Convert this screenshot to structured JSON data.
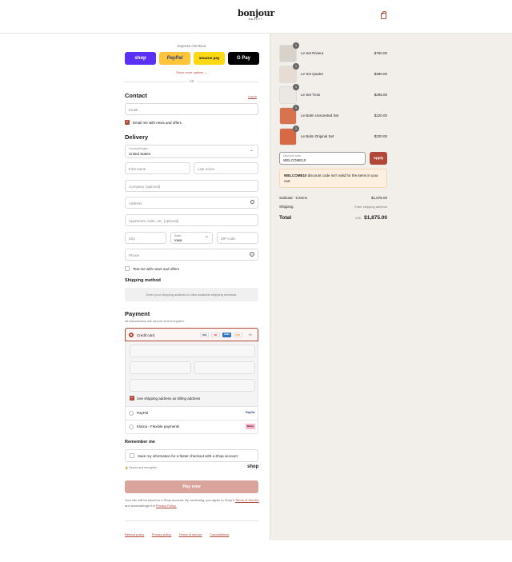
{
  "header": {
    "logo": "bonjour",
    "logo_sub": "BEAUTY",
    "cart_icon": "bag-icon"
  },
  "express": {
    "title": "Express checkout",
    "buttons": [
      {
        "label": "shop",
        "color": "#5a31f4"
      },
      {
        "label": "PayPal",
        "color": "#ffc439"
      },
      {
        "label": "amazon pay",
        "color": "#ffd814"
      },
      {
        "label": "G Pay",
        "color": "#000000"
      }
    ],
    "show_more": "Show more options",
    "or": "OR"
  },
  "contact": {
    "title": "Contact",
    "login": "Log in",
    "email_placeholder": "Email",
    "news_label": "Email me with news and offers"
  },
  "delivery": {
    "title": "Delivery",
    "country_label": "Country/Region",
    "country_value": "United States",
    "first_name": "First name",
    "last_name": "Last name",
    "company": "Company (optional)",
    "address": "Address",
    "apartment": "Apartment, suite, etc. (optional)",
    "city": "City",
    "state_label": "State",
    "state_value": "Iowa",
    "zip": "ZIP code",
    "phone": "Phone",
    "text_label": "Text me with news and offers"
  },
  "shipping_method": {
    "title": "Shipping method",
    "note": "Enter your shipping address to view available shipping methods."
  },
  "payment": {
    "title": "Payment",
    "subtitle": "All transactions are secure and encrypted.",
    "credit_card": "Credit card",
    "card_brands": [
      "VISA",
      "MC",
      "AMEX",
      "DISC",
      "+6"
    ],
    "billing_label": "Use shipping address as billing address",
    "paypal": "PayPal",
    "klarna": "Klarna - Flexible payments"
  },
  "remember": {
    "title": "Remember me",
    "label": "Save my information for a faster checkout with a Shop account",
    "secure": "Secure and encrypted",
    "shop": "shop"
  },
  "pay_button": "Pay now",
  "legal": {
    "line1": "Your info will be saved to a Shop account. By continuing, you agree to Shop's",
    "terms": "Terms of Service",
    "and": "and acknowledge the",
    "privacy": "Privacy Policy."
  },
  "footer_links": [
    "Refund policy",
    "Privacy policy",
    "Terms of service",
    "Cancellations"
  ],
  "order": {
    "items": [
      {
        "name": "Le Set Riviera",
        "price": "$750.00",
        "qty": "1"
      },
      {
        "name": "Le Set Quatre",
        "price": "$390.00",
        "qty": "1"
      },
      {
        "name": "Le Set Trois",
        "price": "$295.00",
        "qty": "1"
      },
      {
        "name": "Le Balm Unscented Set",
        "price": "$220.00",
        "qty": "1"
      },
      {
        "name": "Le Balm Original Set",
        "price": "$220.00",
        "qty": "1"
      }
    ],
    "discount_label": "Discount code",
    "discount_value": "WELCOME10",
    "apply": "Apply",
    "error_code": "WELCOME10",
    "error_text": "discount code isn't valid for the items in your cart",
    "subtotal_label": "Subtotal · 5 items",
    "subtotal_value": "$1,875.00",
    "shipping_label": "Shipping",
    "shipping_value": "Enter shipping address",
    "total_label": "Total",
    "currency": "USD",
    "total_value": "$1,875.00"
  }
}
